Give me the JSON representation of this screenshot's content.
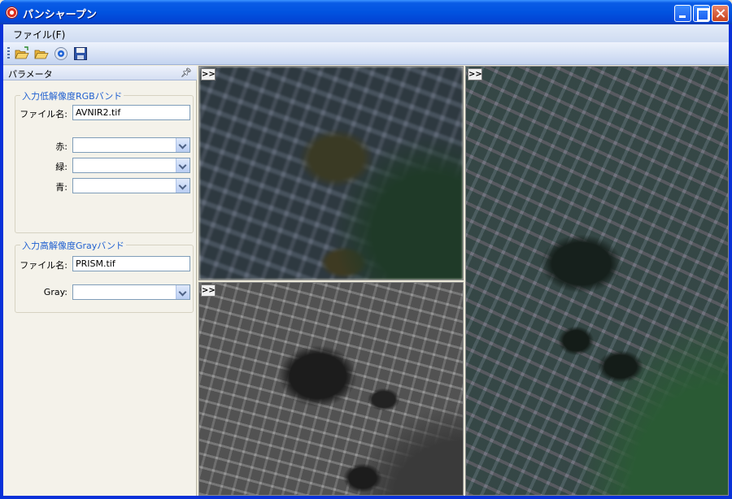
{
  "window": {
    "title": "パンシャープン",
    "controls": {
      "minimize_icon": "minimize-icon",
      "maximize_icon": "maximize-icon",
      "close_icon": "close-icon"
    }
  },
  "menu": {
    "items": [
      {
        "label": "ファイル(F)"
      }
    ]
  },
  "toolbar": {
    "buttons": [
      {
        "icon": "open-folder-icon"
      },
      {
        "icon": "open-folder-icon"
      },
      {
        "icon": "disc-icon"
      },
      {
        "icon": "save-icon"
      }
    ]
  },
  "panel": {
    "title": "パラメータ",
    "pin_glyph": "ᵖ",
    "rgb_group": {
      "title": "入力低解像度RGBバンド",
      "file_label": "ファイル名:",
      "file_value": "AVNIR2.tif",
      "red_label": "赤:",
      "green_label": "緑:",
      "blue_label": "青:",
      "red_value": "",
      "green_value": "",
      "blue_value": ""
    },
    "gray_group": {
      "title": "入力高解像度Grayバンド",
      "file_label": "ファイル名:",
      "file_value": "PRISM.tif",
      "gray_label": "Gray:",
      "gray_value": ""
    }
  },
  "views": {
    "expand_label": ">>"
  }
}
